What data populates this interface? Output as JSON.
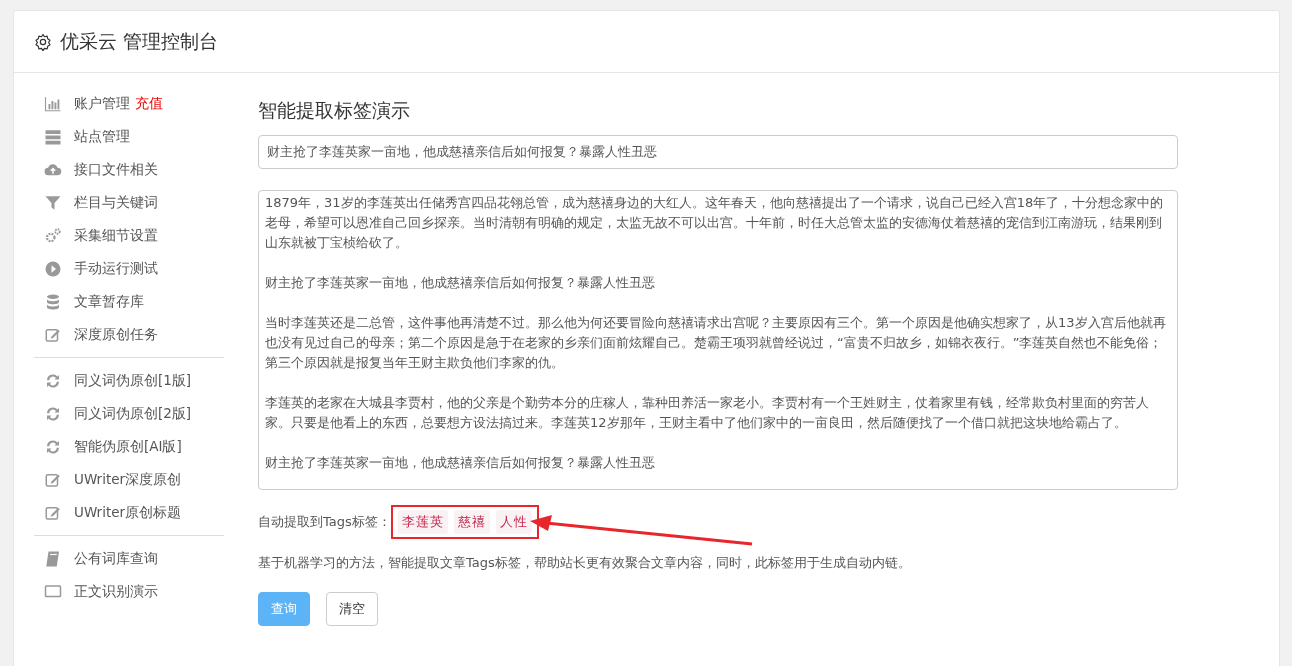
{
  "header": {
    "title": "优采云 管理控制台"
  },
  "sidebar": {
    "groups": [
      {
        "items": [
          {
            "label": "账户管理",
            "kind": "chart",
            "badge": "充值"
          },
          {
            "label": "站点管理",
            "kind": "server"
          },
          {
            "label": "接口文件相关",
            "kind": "cloud"
          },
          {
            "label": "栏目与关键词",
            "kind": "filter"
          },
          {
            "label": "采集细节设置",
            "kind": "gears"
          },
          {
            "label": "手动运行测试",
            "kind": "play"
          },
          {
            "label": "文章暂存库",
            "kind": "database"
          },
          {
            "label": "深度原创任务",
            "kind": "edit"
          }
        ]
      },
      {
        "items": [
          {
            "label": "同义词伪原创[1版]",
            "kind": "refresh"
          },
          {
            "label": "同义词伪原创[2版]",
            "kind": "refresh"
          },
          {
            "label": "智能伪原创[AI版]",
            "kind": "refresh"
          },
          {
            "label": "UWriter深度原创",
            "kind": "edit"
          },
          {
            "label": "UWriter原创标题",
            "kind": "edit"
          }
        ]
      },
      {
        "items": [
          {
            "label": "公有词库查询",
            "kind": "book"
          },
          {
            "label": "正文识别演示",
            "kind": "monitor"
          }
        ]
      }
    ]
  },
  "main": {
    "heading": "智能提取标签演示",
    "title_field": {
      "value": "财主抢了李莲英家一亩地，他成慈禧亲信后如何报复？暴露人性丑恶"
    },
    "content_field": {
      "paragraphs": [
        "1879年，31岁的李莲英出任储秀宫四品花翎总管，成为慈禧身边的大红人。这年春天，他向慈禧提出了一个请求，说自己已经入宫18年了，十分想念家中的老母，希望可以恩准自己回乡探亲。当时清朝有明确的规定，太监无故不可以出宫。十年前，时任大总管太监的安德海仗着慈禧的宠信到江南游玩，结果刚到山东就被丁宝桢给砍了。",
        "财主抢了李莲英家一亩地，他成慈禧亲信后如何报复？暴露人性丑恶",
        "当时李莲英还是二总管，这件事他再清楚不过。那么他为何还要冒险向慈禧请求出宫呢？主要原因有三个。第一个原因是他确实想家了，从13岁入宫后他就再也没有见过自己的母亲；第二个原因是急于在老家的乡亲们面前炫耀自己。楚霸王项羽就曾经说过，“富贵不归故乡，如锦衣夜行。”李莲英自然也不能免俗；第三个原因就是报复当年王财主欺负他们李家的仇。",
        "李莲英的老家在大城县李贾村，他的父亲是个勤劳本分的庄稼人，靠种田养活一家老小。李贾村有一个王姓财主，仗着家里有钱，经常欺负村里面的穷苦人家。只要是他看上的东西，总要想方设法搞过来。李莲英12岁那年，王财主看中了他们家中的一亩良田，然后随便找了一个借口就把这块地给霸占了。",
        "财主抢了李莲英家一亩地，他成慈禧亲信后如何报复？暴露人性丑恶"
      ]
    },
    "tags_label": "自动提取到Tags标签：",
    "tags": [
      "李莲英",
      "慈禧",
      "人性"
    ],
    "tags_highlighted": true,
    "description": "基于机器学习的方法，智能提取文章Tags标签，帮助站长更有效聚合文章内容，同时，此标签用于生成自动内链。",
    "buttons": [
      {
        "label": "查询",
        "kind": "primary"
      },
      {
        "label": "清空",
        "kind": "default"
      }
    ]
  }
}
